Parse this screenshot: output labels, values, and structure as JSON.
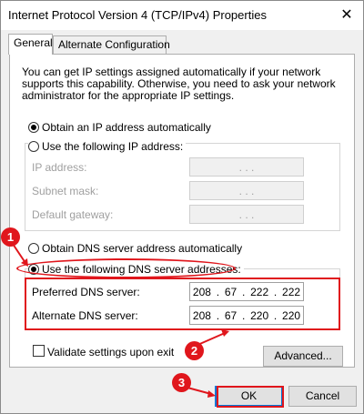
{
  "window": {
    "title": "Internet Protocol Version 4 (TCP/IPv4) Properties",
    "close_glyph": "✕"
  },
  "tabs": [
    {
      "label": "General",
      "active": true
    },
    {
      "label": "Alternate Configuration",
      "active": false
    }
  ],
  "description": "You can get IP settings assigned automatically if your network supports this capability. Otherwise, you need to ask your network administrator for the appropriate IP settings.",
  "ip_settings": {
    "obtain_auto_label": "Obtain an IP address automatically",
    "use_following_label": "Use the following IP address:",
    "selected": "obtain_auto",
    "fields": [
      {
        "label": "IP address:",
        "value": ".   .   ."
      },
      {
        "label": "Subnet mask:",
        "value": ".   .   ."
      },
      {
        "label": "Default gateway:",
        "value": ".   .   ."
      }
    ]
  },
  "dns_settings": {
    "obtain_auto_label": "Obtain DNS server address automatically",
    "use_following_label": "Use the following DNS server addresses:",
    "selected": "use_following",
    "preferred": {
      "label": "Preferred DNS server:",
      "octets": [
        "208",
        "67",
        "222",
        "222"
      ]
    },
    "alternate": {
      "label": "Alternate DNS server:",
      "octets": [
        "208",
        "67",
        "220",
        "220"
      ]
    }
  },
  "validate_label": "Validate settings upon exit",
  "buttons": {
    "advanced": "Advanced...",
    "ok": "OK",
    "cancel": "Cancel"
  },
  "annotations": {
    "badge_1": "1",
    "badge_2": "2",
    "badge_3": "3",
    "accent_color": "#e0161c"
  }
}
